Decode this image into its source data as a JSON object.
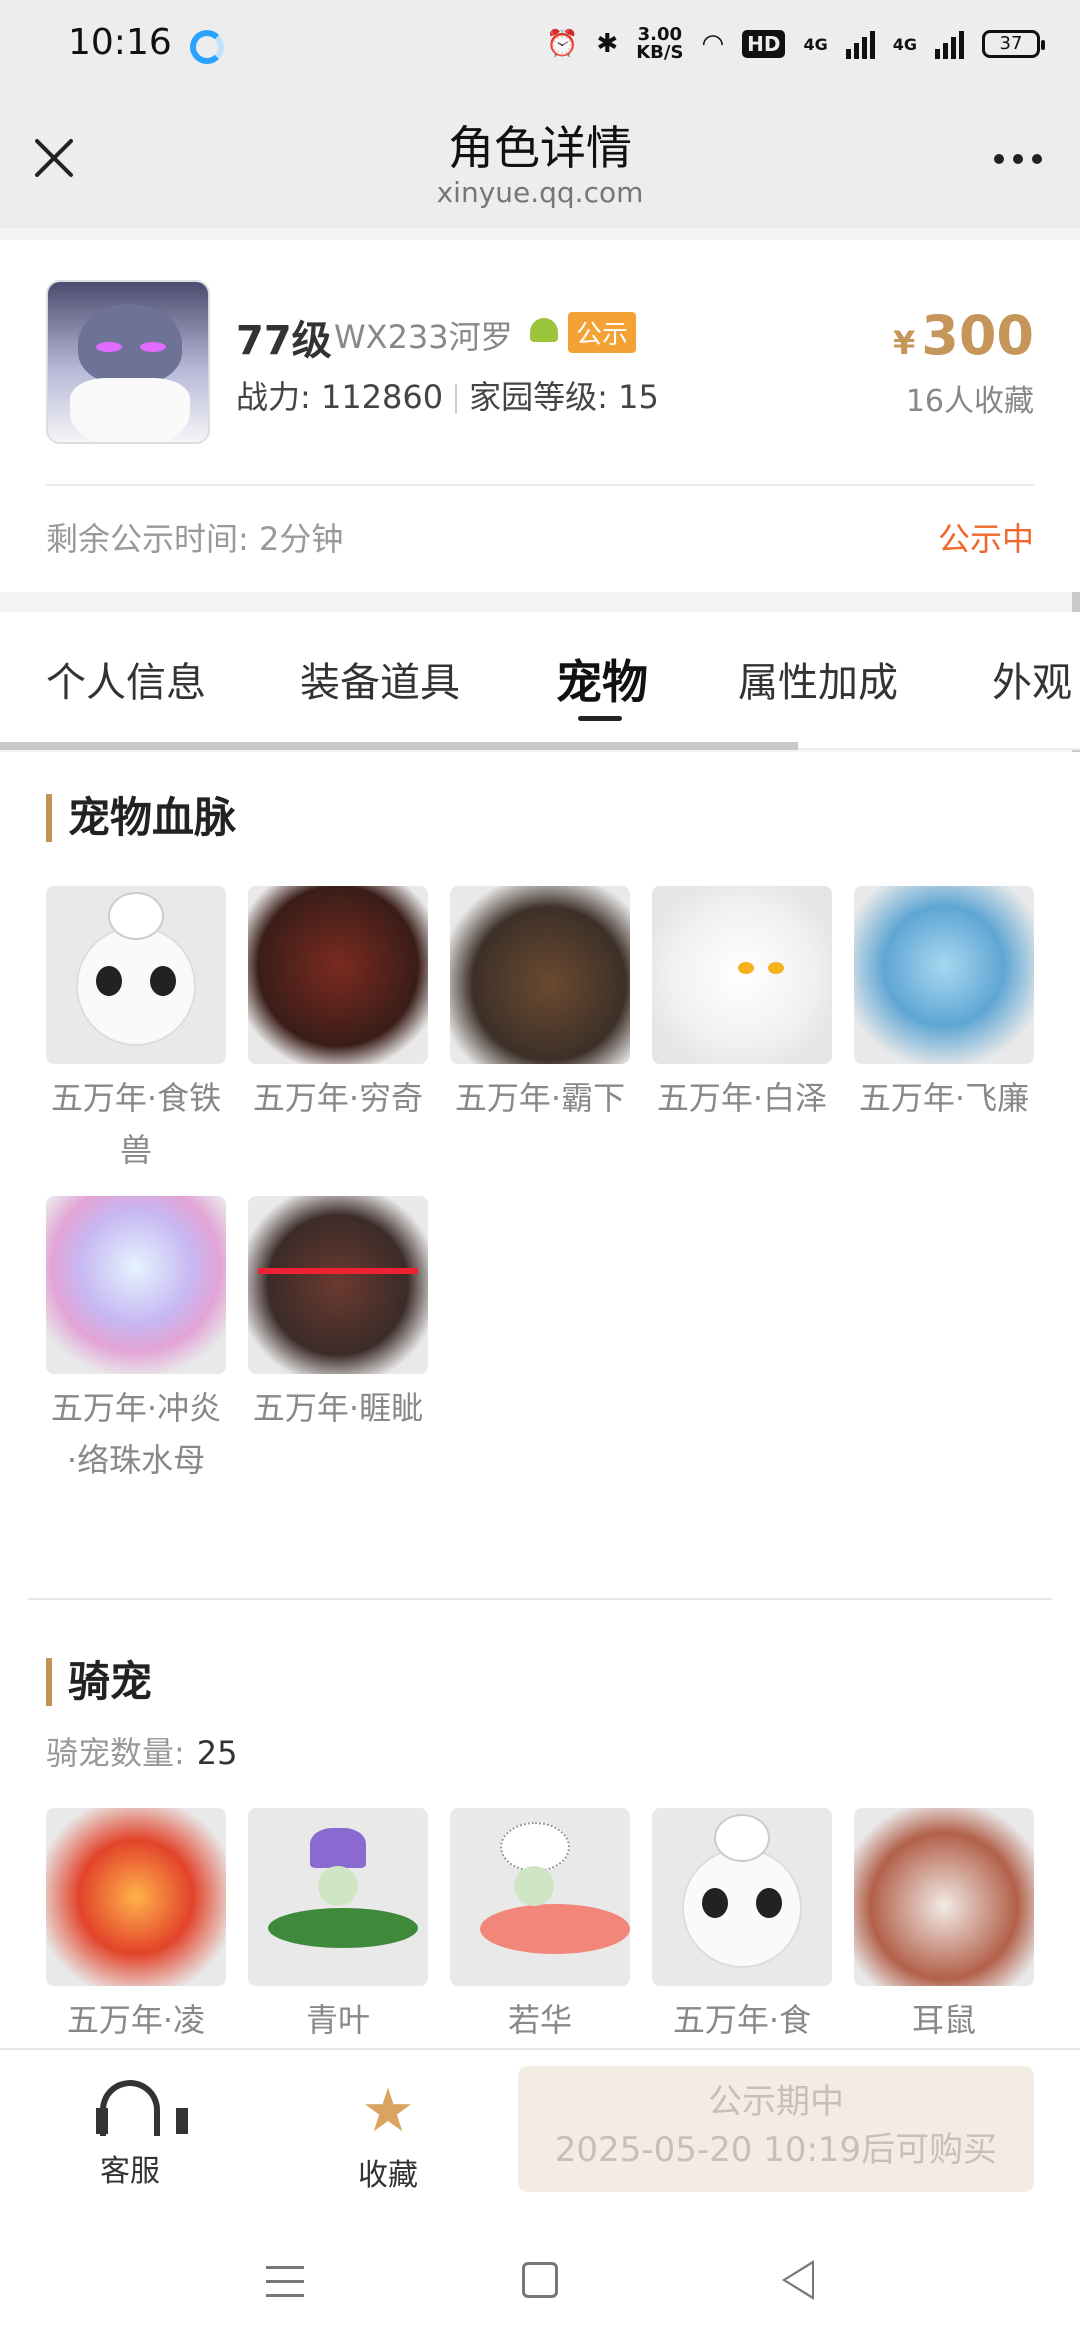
{
  "status_bar": {
    "time": "10:16",
    "speed": "3.00",
    "speed_unit": "KB/S",
    "hd": "HD",
    "net1": "4G",
    "net2": "4G",
    "battery": "37"
  },
  "nav": {
    "title": "角色详情",
    "subtitle": "xinyue.qq.com"
  },
  "role": {
    "level": "77级",
    "server": "WX233河罗",
    "badge": "公示",
    "power": "战力: 112860",
    "home_level": "家园等级: 15",
    "price_symbol": "¥",
    "price": "300",
    "favorites": "16人收藏",
    "remaining": "剩余公示时间: 2分钟",
    "status": "公示中"
  },
  "tabs": [
    "个人信息",
    "装备道具",
    "宠物",
    "属性加成",
    "外观"
  ],
  "pet_section": {
    "title": "宠物血脉",
    "items": [
      {
        "name": "五万年·食铁兽",
        "icon": "panda"
      },
      {
        "name": "五万年·穷奇",
        "icon": "beast-red"
      },
      {
        "name": "五万年·霸下",
        "icon": "dragon"
      },
      {
        "name": "五万年·白泽",
        "icon": "white-cat"
      },
      {
        "name": "五万年·飞廉",
        "icon": "ice-bird"
      },
      {
        "name": "五万年·冲炎·络珠水母",
        "icon": "jellyfish"
      },
      {
        "name": "五万年·睚眦",
        "icon": "red-dragon"
      }
    ]
  },
  "mount_section": {
    "title": "骑宠",
    "count_label": "骑宠数量:",
    "count": "25",
    "items": [
      {
        "name": "五万年·凌",
        "icon": "phoenix"
      },
      {
        "name": "青叶",
        "icon": "flower-sprite"
      },
      {
        "name": "若华",
        "icon": "dandelion-sprite"
      },
      {
        "name": "五万年·食",
        "icon": "panda"
      },
      {
        "name": "耳鼠",
        "icon": "squirrel"
      }
    ]
  },
  "bottom": {
    "service": "客服",
    "favorite": "收藏",
    "buy_line1": "公示期中",
    "buy_line2": "2025-05-20 10:19后可购买"
  }
}
